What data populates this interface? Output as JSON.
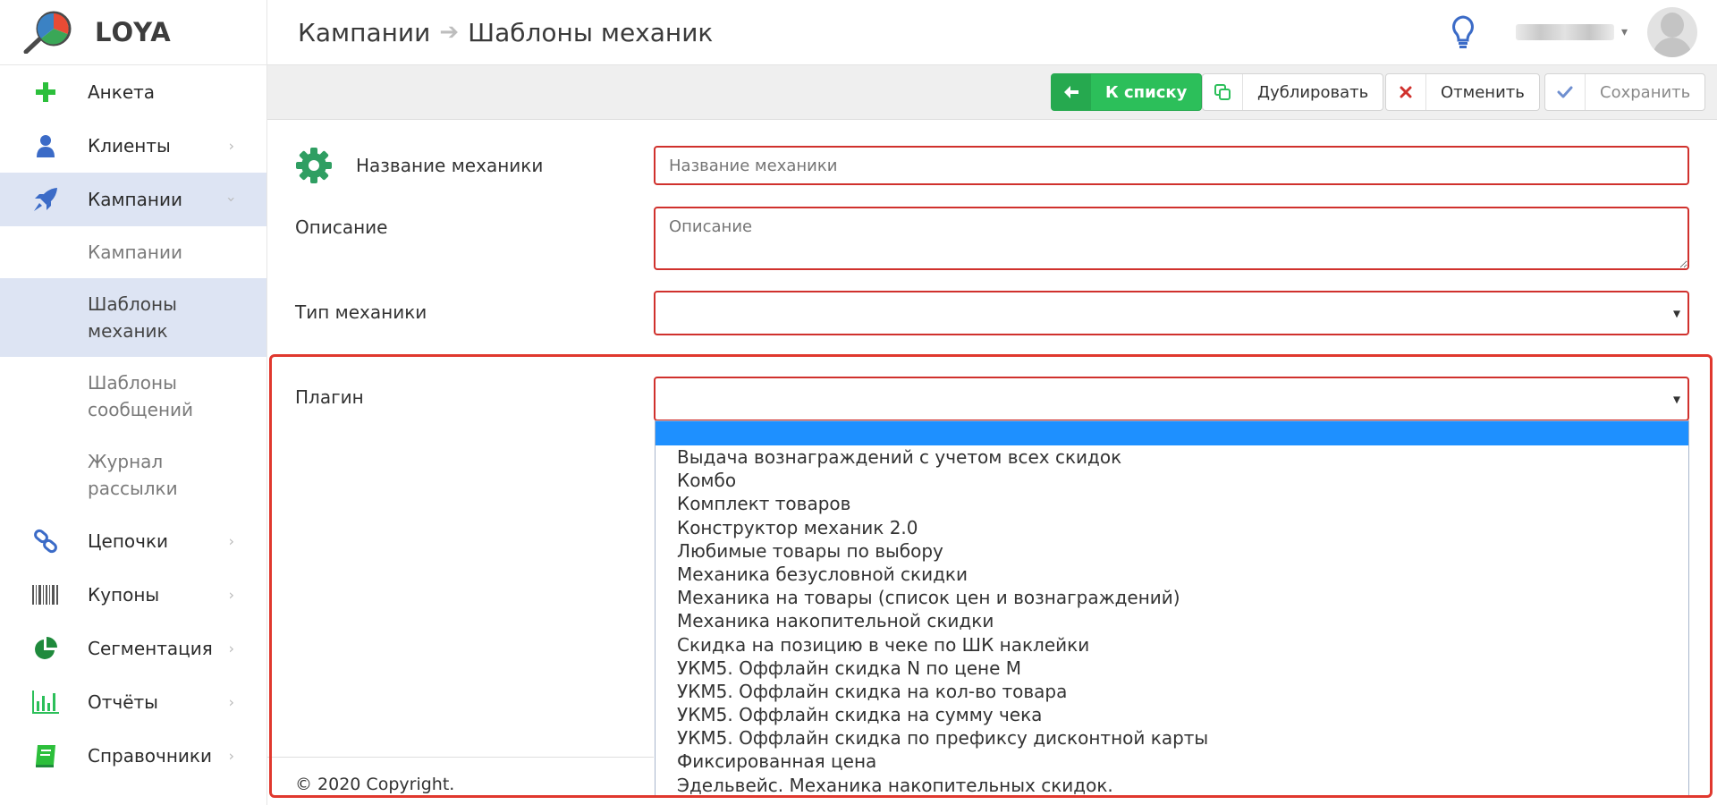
{
  "app": {
    "name": "LOYA"
  },
  "sidebar": {
    "items": [
      {
        "label": "Анкета"
      },
      {
        "label": "Клиенты"
      },
      {
        "label": "Кампании"
      },
      {
        "label": "Цепочки"
      },
      {
        "label": "Купоны"
      },
      {
        "label": "Сегментация"
      },
      {
        "label": "Отчёты"
      },
      {
        "label": "Справочники"
      }
    ],
    "sub_items": [
      {
        "label": "Кампании"
      },
      {
        "label": "Шаблоны механик"
      },
      {
        "label": "Шаблоны сообщений"
      },
      {
        "label": "Журнал рассылки"
      }
    ]
  },
  "header": {
    "breadcrumb": [
      "Кампании",
      "Шаблоны механик"
    ],
    "arrow": "➔"
  },
  "toolbar": {
    "back_label": "К списку",
    "duplicate_label": "Дублировать",
    "cancel_label": "Отменить",
    "save_label": "Сохранить"
  },
  "form": {
    "name": {
      "label": "Название механики",
      "placeholder": "Название механики",
      "value": ""
    },
    "description": {
      "label": "Описание",
      "placeholder": "Описание",
      "value": ""
    },
    "type": {
      "label": "Тип механики",
      "value": ""
    },
    "plugin": {
      "label": "Плагин",
      "value": "",
      "options": [
        "Выдача вознаграждений с учетом всех скидок",
        "Комбо",
        "Комплект товаров",
        "Конструктор механик 2.0",
        "Любимые товары по выбору",
        "Механика безусловной скидки",
        "Механика на товары (список цен и вознаграждений)",
        "Механика накопительной скидки",
        "Скидка на позицию в чеке по ШК наклейки",
        "УКМ5. Оффлайн скидка N по цене M",
        "УКМ5. Оффлайн скидка на кол-во товара",
        "УКМ5. Оффлайн скидка на сумму чека",
        "УКМ5. Оффлайн скидка по префиксу дисконтной карты",
        "Фиксированная цена",
        "Эдельвейс. Механика накопительных скидок."
      ]
    }
  },
  "footer": {
    "copyright": "© 2020 Copyright."
  },
  "colors": {
    "accent_green": "#2cbf5a",
    "error_red": "#d0312d",
    "highlight_blue": "#1e90ff",
    "active_nav": "#dde4f3",
    "annotation_red": "#e0382e"
  },
  "icons": {
    "sidebar": [
      "plus-icon",
      "user-icon",
      "rocket-icon",
      "chain-icon",
      "barcode-icon",
      "pie-chart-icon",
      "bar-chart-icon",
      "book-icon"
    ],
    "header": [
      "lightbulb-icon",
      "avatar"
    ],
    "toolbar": [
      "arrow-left-icon",
      "copy-icon",
      "close-icon",
      "check-icon"
    ],
    "form": [
      "gear-icon"
    ]
  }
}
